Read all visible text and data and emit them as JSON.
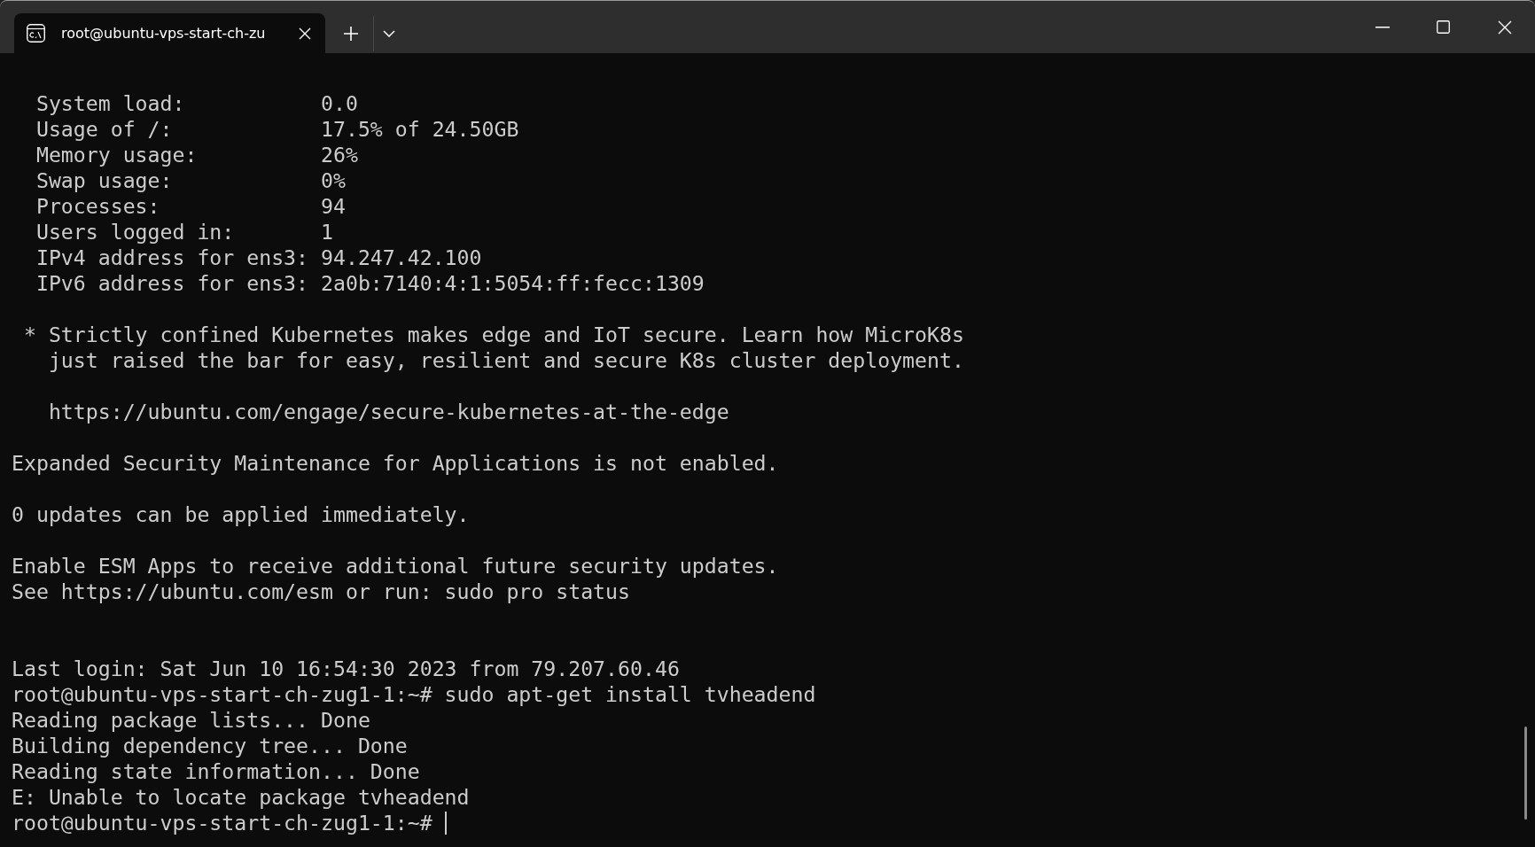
{
  "tabs": [
    {
      "title": "root@ubuntu-vps-start-ch-zu",
      "selected": true
    }
  ],
  "terminal": {
    "cursor": true,
    "lines": [
      {
        "kind": "text",
        "text": "  System load:           0.0"
      },
      {
        "kind": "text",
        "text": "  Usage of /:            17.5% of 24.50GB"
      },
      {
        "kind": "text",
        "text": "  Memory usage:          26%"
      },
      {
        "kind": "text",
        "text": "  Swap usage:            0%"
      },
      {
        "kind": "text",
        "text": "  Processes:             94"
      },
      {
        "kind": "text",
        "text": "  Users logged in:       1"
      },
      {
        "kind": "text",
        "text": "  IPv4 address for ens3: 94.247.42.100"
      },
      {
        "kind": "text",
        "text": "  IPv6 address for ens3: 2a0b:7140:4:1:5054:ff:fecc:1309"
      },
      {
        "kind": "blank"
      },
      {
        "kind": "text",
        "text": " * Strictly confined Kubernetes makes edge and IoT secure. Learn how MicroK8s"
      },
      {
        "kind": "text",
        "text": "   just raised the bar for easy, resilient and secure K8s cluster deployment."
      },
      {
        "kind": "blank"
      },
      {
        "kind": "text",
        "text": "   https://ubuntu.com/engage/secure-kubernetes-at-the-edge"
      },
      {
        "kind": "blank"
      },
      {
        "kind": "text",
        "text": "Expanded Security Maintenance for Applications is not enabled."
      },
      {
        "kind": "blank"
      },
      {
        "kind": "text",
        "text": "0 updates can be applied immediately."
      },
      {
        "kind": "blank"
      },
      {
        "kind": "text",
        "text": "Enable ESM Apps to receive additional future security updates."
      },
      {
        "kind": "text",
        "text": "See https://ubuntu.com/esm or run: sudo pro status"
      },
      {
        "kind": "blank"
      },
      {
        "kind": "blank"
      },
      {
        "kind": "text",
        "text": "Last login: Sat Jun 10 16:54:30 2023 from 79.207.60.46"
      },
      {
        "kind": "text",
        "text": "root@ubuntu-vps-start-ch-zug1-1:~# sudo apt-get install tvheadend"
      },
      {
        "kind": "text",
        "text": "Reading package lists... Done"
      },
      {
        "kind": "text",
        "text": "Building dependency tree... Done"
      },
      {
        "kind": "text",
        "text": "Reading state information... Done"
      },
      {
        "kind": "text",
        "text": "E: Unable to locate package tvheadend"
      },
      {
        "kind": "text",
        "text": "root@ubuntu-vps-start-ch-zug1-1:~# "
      }
    ]
  }
}
